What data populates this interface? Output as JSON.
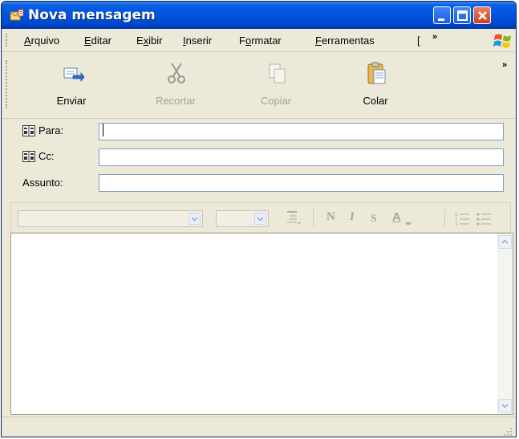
{
  "window": {
    "title": "Nova mensagem",
    "controls": [
      "minimize-icon",
      "maximize-icon",
      "close-icon"
    ]
  },
  "menu": {
    "items": [
      {
        "pre": "",
        "mn": "A",
        "post": "rquivo"
      },
      {
        "pre": "",
        "mn": "E",
        "post": "ditar"
      },
      {
        "pre": "E",
        "mn": "x",
        "post": "ibir"
      },
      {
        "pre": "",
        "mn": "I",
        "post": "nserir"
      },
      {
        "pre": "F",
        "mn": "o",
        "post": "rmatar"
      },
      {
        "pre": "",
        "mn": "F",
        "post": "erramentas"
      },
      {
        "pre": "",
        "mn": "",
        "post": "["
      }
    ],
    "overflow_chevron": "»"
  },
  "toolbar": {
    "buttons": [
      {
        "label": "Enviar",
        "icon": "send-icon",
        "enabled": true
      },
      {
        "label": "Recortar",
        "icon": "scissors-icon",
        "enabled": false
      },
      {
        "label": "Copiar",
        "icon": "copy-icon",
        "enabled": false
      },
      {
        "label": "Colar",
        "icon": "paste-icon",
        "enabled": true
      }
    ],
    "overflow_chevron": "»"
  },
  "header": {
    "to_label": "Para:",
    "to_value": "",
    "cc_label": "Cc:",
    "cc_value": "",
    "subject_label": "Assunto:",
    "subject_value": ""
  },
  "format_bar": {
    "font_name": "",
    "font_size": "",
    "bold": "N",
    "italic": "I",
    "underline": "S",
    "font_color": "A",
    "enabled": false
  },
  "body": {
    "text": ""
  },
  "colors": {
    "title_bar": "#0053e1",
    "chrome": "#ece9d8",
    "close_button": "#c9431d",
    "input_border": "#7f9db9"
  }
}
